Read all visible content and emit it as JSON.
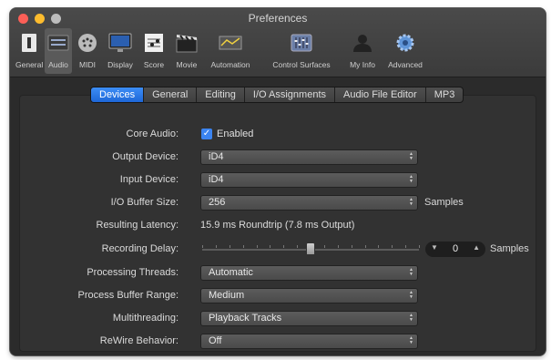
{
  "window": {
    "title": "Preferences"
  },
  "toolbar": {
    "items": [
      {
        "label": "General",
        "icon": "general-icon"
      },
      {
        "label": "Audio",
        "icon": "audio-icon"
      },
      {
        "label": "MIDI",
        "icon": "midi-icon"
      },
      {
        "label": "Display",
        "icon": "display-icon"
      },
      {
        "label": "Score",
        "icon": "score-icon"
      },
      {
        "label": "Movie",
        "icon": "movie-icon"
      },
      {
        "label": "Automation",
        "icon": "automation-icon"
      },
      {
        "label": "Control Surfaces",
        "icon": "control-surfaces-icon"
      },
      {
        "label": "My Info",
        "icon": "my-info-icon"
      },
      {
        "label": "Advanced",
        "icon": "advanced-icon"
      }
    ],
    "active": "Audio"
  },
  "tabs": {
    "items": [
      "Devices",
      "General",
      "Editing",
      "I/O Assignments",
      "Audio File Editor",
      "MP3"
    ],
    "active": "Devices"
  },
  "settings": {
    "core_audio": {
      "label": "Core Audio:",
      "value": "Enabled",
      "checked": true
    },
    "output_device": {
      "label": "Output Device:",
      "value": "iD4"
    },
    "input_device": {
      "label": "Input Device:",
      "value": "iD4"
    },
    "io_buffer_size": {
      "label": "I/O Buffer Size:",
      "value": "256",
      "suffix": "Samples"
    },
    "resulting_latency": {
      "label": "Resulting Latency:",
      "value": "15.9 ms Roundtrip (7.8 ms Output)"
    },
    "recording_delay": {
      "label": "Recording Delay:",
      "value": "0",
      "suffix": "Samples",
      "slider_position": 0.5
    },
    "processing_threads": {
      "label": "Processing Threads:",
      "value": "Automatic"
    },
    "process_buffer_range": {
      "label": "Process Buffer Range:",
      "value": "Medium"
    },
    "multithreading": {
      "label": "Multithreading:",
      "value": "Playback Tracks"
    },
    "rewire_behavior": {
      "label": "ReWire Behavior:",
      "value": "Off"
    }
  },
  "colors": {
    "accent": "#2a79e6",
    "window_bg": "#2c2c2c",
    "panel_bg": "#323232"
  }
}
